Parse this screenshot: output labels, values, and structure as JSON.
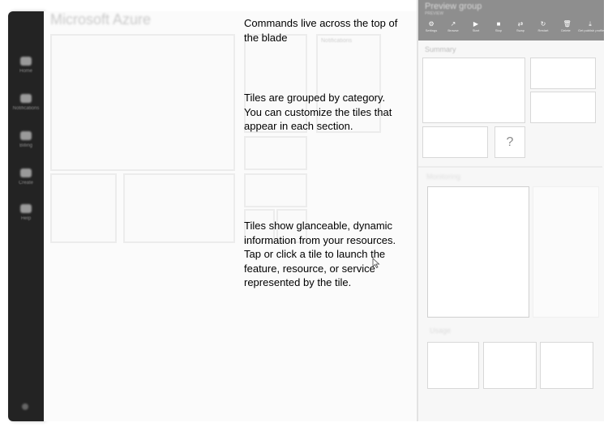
{
  "sidebar": {
    "items": [
      {
        "icon": "browse-icon",
        "label": "Home"
      },
      {
        "icon": "notifications-icon",
        "label": "Notifications"
      },
      {
        "icon": "billing-icon",
        "label": "Billing"
      },
      {
        "icon": "create-icon",
        "label": "Create"
      },
      {
        "icon": "help-icon",
        "label": "Help"
      }
    ]
  },
  "portal": {
    "title": "Microsoft Azure",
    "tile_label": "Notifications"
  },
  "annotations": [
    {
      "line1": "Commands live across the top of",
      "line2": "the blade"
    },
    {
      "line1": "Tiles are grouped by category.",
      "line2": "You can customize the tiles that",
      "line3": "appear in each section."
    },
    {
      "line1": "Tiles show glanceable, dynamic",
      "line2": "information from your resources.",
      "line3": "Tap or click a tile to launch the",
      "line4": "feature, resource, or service",
      "line5": "represented by the tile."
    }
  ],
  "blade": {
    "title": "Preview group",
    "subtitle": "PREVIEW",
    "commands": [
      {
        "icon": "settings-icon",
        "label": "Settings"
      },
      {
        "icon": "browse-icon",
        "label": "Browse"
      },
      {
        "icon": "start-icon",
        "label": "Start"
      },
      {
        "icon": "stop-icon",
        "label": "Stop"
      },
      {
        "icon": "swap-icon",
        "label": "Swap"
      },
      {
        "icon": "restart-icon",
        "label": "Restart"
      },
      {
        "icon": "delete-icon",
        "label": "Delete"
      },
      {
        "icon": "get-publish-profile-icon",
        "label": "Get publish profile"
      }
    ],
    "sections": {
      "summary": "Summary",
      "monitoring": "Monitoring",
      "usage": "Usage"
    },
    "question_tile": "?"
  }
}
